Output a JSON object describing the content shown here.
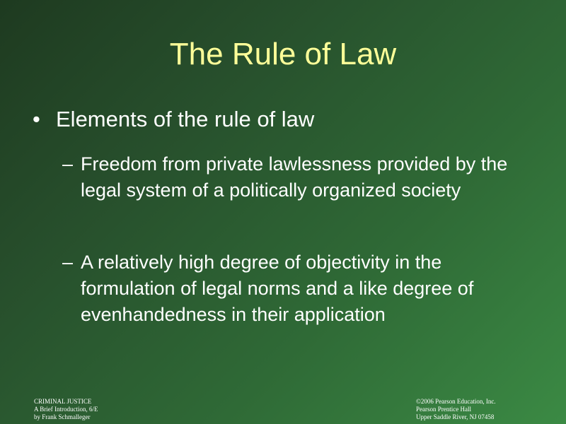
{
  "slide": {
    "title": "The Rule of Law",
    "bullet_marker": "•",
    "sub_marker": "–",
    "bullet": "Elements of the rule of law",
    "sub_bullets": [
      "Freedom from private lawlessness provided by the legal system of a politically organized society",
      "A relatively high degree of objectivity in the formulation of legal norms and a like degree of evenhandedness in their application"
    ]
  },
  "footer": {
    "left": [
      "CRIMINAL JUSTICE",
      "A Brief Introduction, 6/E",
      "by Frank Schmalleger"
    ],
    "right": [
      "©2006 Pearson Education, Inc.",
      "Pearson Prentice Hall",
      "Upper Saddle River, NJ 07458"
    ]
  },
  "colors": {
    "title": "#ffff99",
    "body_text": "#ffffff",
    "background_dark": "#1e3a20",
    "background_light": "#3b8a44"
  }
}
